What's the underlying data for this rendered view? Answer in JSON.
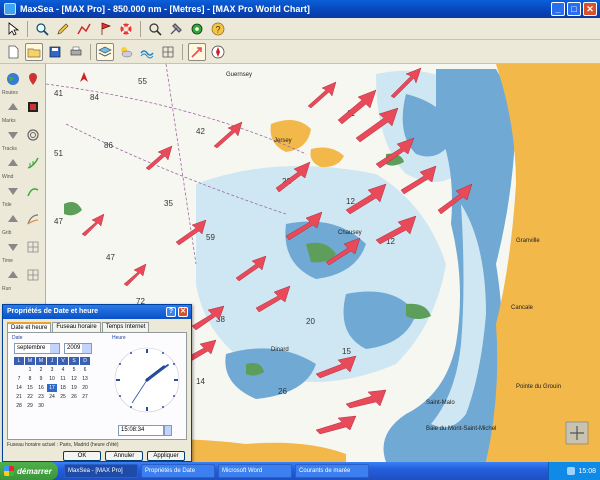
{
  "window": {
    "title": "MaxSea - [MAX Pro] - 850.000 nm - [Metres] - [MAX Pro World Chart]",
    "min_label": "_",
    "max_label": "□",
    "close_label": "✕"
  },
  "toolbar_row1": [
    "cursor-icon",
    "zoom-icon",
    "pencil-icon",
    "route-icon",
    "mark-icon",
    "lifebuoy-icon",
    "search-icon",
    "tools-icon",
    "gps-icon",
    "help-icon"
  ],
  "toolbar_row2": [
    "new-icon",
    "open-icon",
    "save-icon",
    "print-icon",
    "layers-icon",
    "weather-icon",
    "tide-icon",
    "grid-icon",
    "arrow-icon",
    "compass-icon"
  ],
  "palette": {
    "labels": [
      "Routes",
      "Marks",
      "Tracks",
      "Wind",
      "Tide",
      "Grib",
      "Time",
      "Run"
    ]
  },
  "chart": {
    "depth_labels": [
      "41",
      "55",
      "84",
      "51",
      "86",
      "42",
      "47",
      "35",
      "47",
      "59",
      "72",
      "38",
      "41",
      "22",
      "12",
      "12",
      "20",
      "15",
      "26",
      "14"
    ],
    "place_labels": [
      "Guernsey",
      "Jersey",
      "Chausey",
      "Granville",
      "Saint-Malo",
      "Baie du Mont-Saint-Michel",
      "Cancale",
      "Dinard",
      "Pointe du Grouin"
    ],
    "colors": {
      "deep": "#f7f7f2",
      "shallow": "#cfe7f2",
      "shoal": "#6fa9d4",
      "land": "#f2b84a",
      "drying": "#5c9e5a",
      "arrow": "#e84a5a"
    }
  },
  "dialog": {
    "title": "Propriétés de Date et heure",
    "help_label": "?",
    "close_label": "✕",
    "tabs": [
      "Date et heure",
      "Fuseau horaire",
      "Temps Internet"
    ],
    "date_section": "Date",
    "time_section": "Heure",
    "month": "septembre",
    "year": "2009",
    "weekdays": [
      "L",
      "M",
      "M",
      "J",
      "V",
      "S",
      "D"
    ],
    "days": [
      "",
      "1",
      "2",
      "3",
      "4",
      "5",
      "6",
      "7",
      "8",
      "9",
      "10",
      "11",
      "12",
      "13",
      "14",
      "15",
      "16",
      "17",
      "18",
      "19",
      "20",
      "21",
      "22",
      "23",
      "24",
      "25",
      "26",
      "27",
      "28",
      "29",
      "30",
      "",
      "",
      "",
      ""
    ],
    "selected_day": "17",
    "time": "15:08:34",
    "timezone": "Fuseau horaire actuel : Paris, Madrid (heure d'été)",
    "ok_label": "OK",
    "cancel_label": "Annuler",
    "apply_label": "Appliquer"
  },
  "taskbar": {
    "start_label": "démarrer",
    "items": [
      "MaxSea - [MAX Pro]",
      "Propriétés de Date",
      "Microsoft Word",
      "Courants de marée"
    ],
    "clock": "15:08"
  }
}
